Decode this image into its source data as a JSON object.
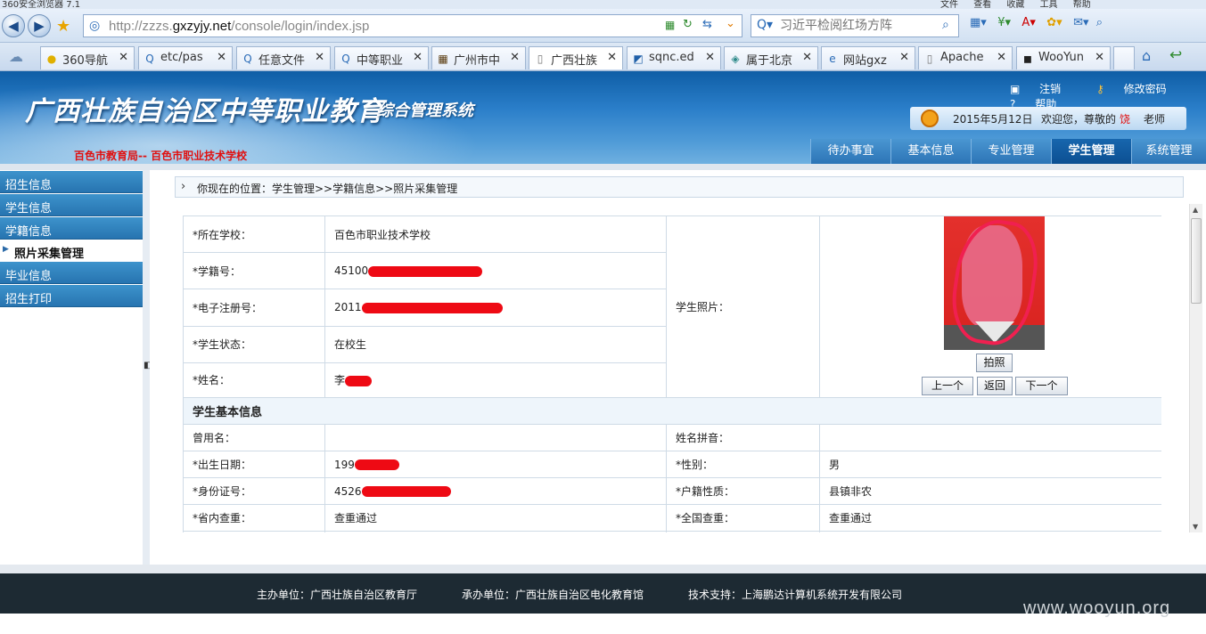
{
  "browser": {
    "window_title": "360安全浏览器 7.1",
    "menus": [
      "文件",
      "查看",
      "收藏",
      "工具",
      "帮助"
    ],
    "url_prefix": "http://zzzs.",
    "url_domain": "gxzyjy.net",
    "url_path": "/console/login/index.jsp",
    "search_placeholder": "习近平检阅红场方阵",
    "tabs": [
      {
        "label": "360导航",
        "icon": "360-icon"
      },
      {
        "label": "etc/pas",
        "icon": "search-icon"
      },
      {
        "label": "任意文件",
        "icon": "search-icon"
      },
      {
        "label": "中等职业",
        "icon": "search-icon"
      },
      {
        "label": "广州市中",
        "icon": "grid-icon"
      },
      {
        "label": "广西壮族",
        "icon": "page-icon"
      },
      {
        "label": "sqnc.ed",
        "icon": "site-icon"
      },
      {
        "label": "属于北京",
        "icon": "site-icon"
      },
      {
        "label": "网站gxz",
        "icon": "ie-icon"
      },
      {
        "label": "Apache",
        "icon": "page-icon"
      },
      {
        "label": "WooYun",
        "icon": "wooyun-icon"
      }
    ]
  },
  "header": {
    "title": "广西壮族自治区中等职业教育",
    "subtitle": "综合管理系统",
    "org": "百色市教育局-- 百色市职业技术学校",
    "links": {
      "logout": "注销",
      "change_password": "修改密码",
      "help": "帮助"
    },
    "date": "2015年5月12日",
    "welcome": "欢迎您，尊敬的",
    "user_name": "饶",
    "role": "老师",
    "nav": [
      "待办事宜",
      "基本信息",
      "专业管理",
      "学生管理",
      "系统管理"
    ],
    "nav_active": "学生管理"
  },
  "sidebar": {
    "items": [
      "招生信息",
      "学生信息",
      "学籍信息"
    ],
    "active_sub": "照片采集管理",
    "items_after": [
      "毕业信息",
      "招生打印"
    ]
  },
  "breadcrumb": "你现在的位置：学生管理>>学籍信息>>照片采集管理",
  "form": {
    "school_label": "*所在学校：",
    "school_value": "百色市职业技术学校",
    "reg_no_label": "*学籍号：",
    "reg_no_prefix": "45100",
    "e_reg_label": "*电子注册号：",
    "e_reg_prefix": "2011",
    "status_label": "*学生状态：",
    "status_value": "在校生",
    "name_label": "*姓名：",
    "name_prefix": "李",
    "photo_label": "学生照片：",
    "photo_buttons": {
      "capture": "拍照",
      "prev": "上一个",
      "back": "返回",
      "next": "下一个"
    },
    "section_title": "学生基本信息",
    "former_name_label": "曾用名：",
    "pinyin_label": "姓名拼音：",
    "birth_label": "*出生日期：",
    "birth_prefix": "199",
    "gender_label": "*性别：",
    "gender_value": "男",
    "id_label": "*身份证号：",
    "id_prefix": "4526",
    "household_label": "*户籍性质：",
    "household_value": "县镇非农",
    "province_check_label": "*省内查重：",
    "province_check_value": "查重通过",
    "national_check_label": "*全国查重：",
    "national_check_value": "查重通过"
  },
  "footer": {
    "host": "主办单位：广西壮族自治区教育厅",
    "organizer": "承办单位：广西壮族自治区电化教育馆",
    "support": "技术支持：上海鹏达计算机系统开发有限公司"
  },
  "watermark": "www.wooyun.org",
  "colors": {
    "header_blue": "#2a7ec9",
    "nav_active": "#0c4f92",
    "redact": "#ee0a14",
    "footer": "#1d2a33"
  }
}
